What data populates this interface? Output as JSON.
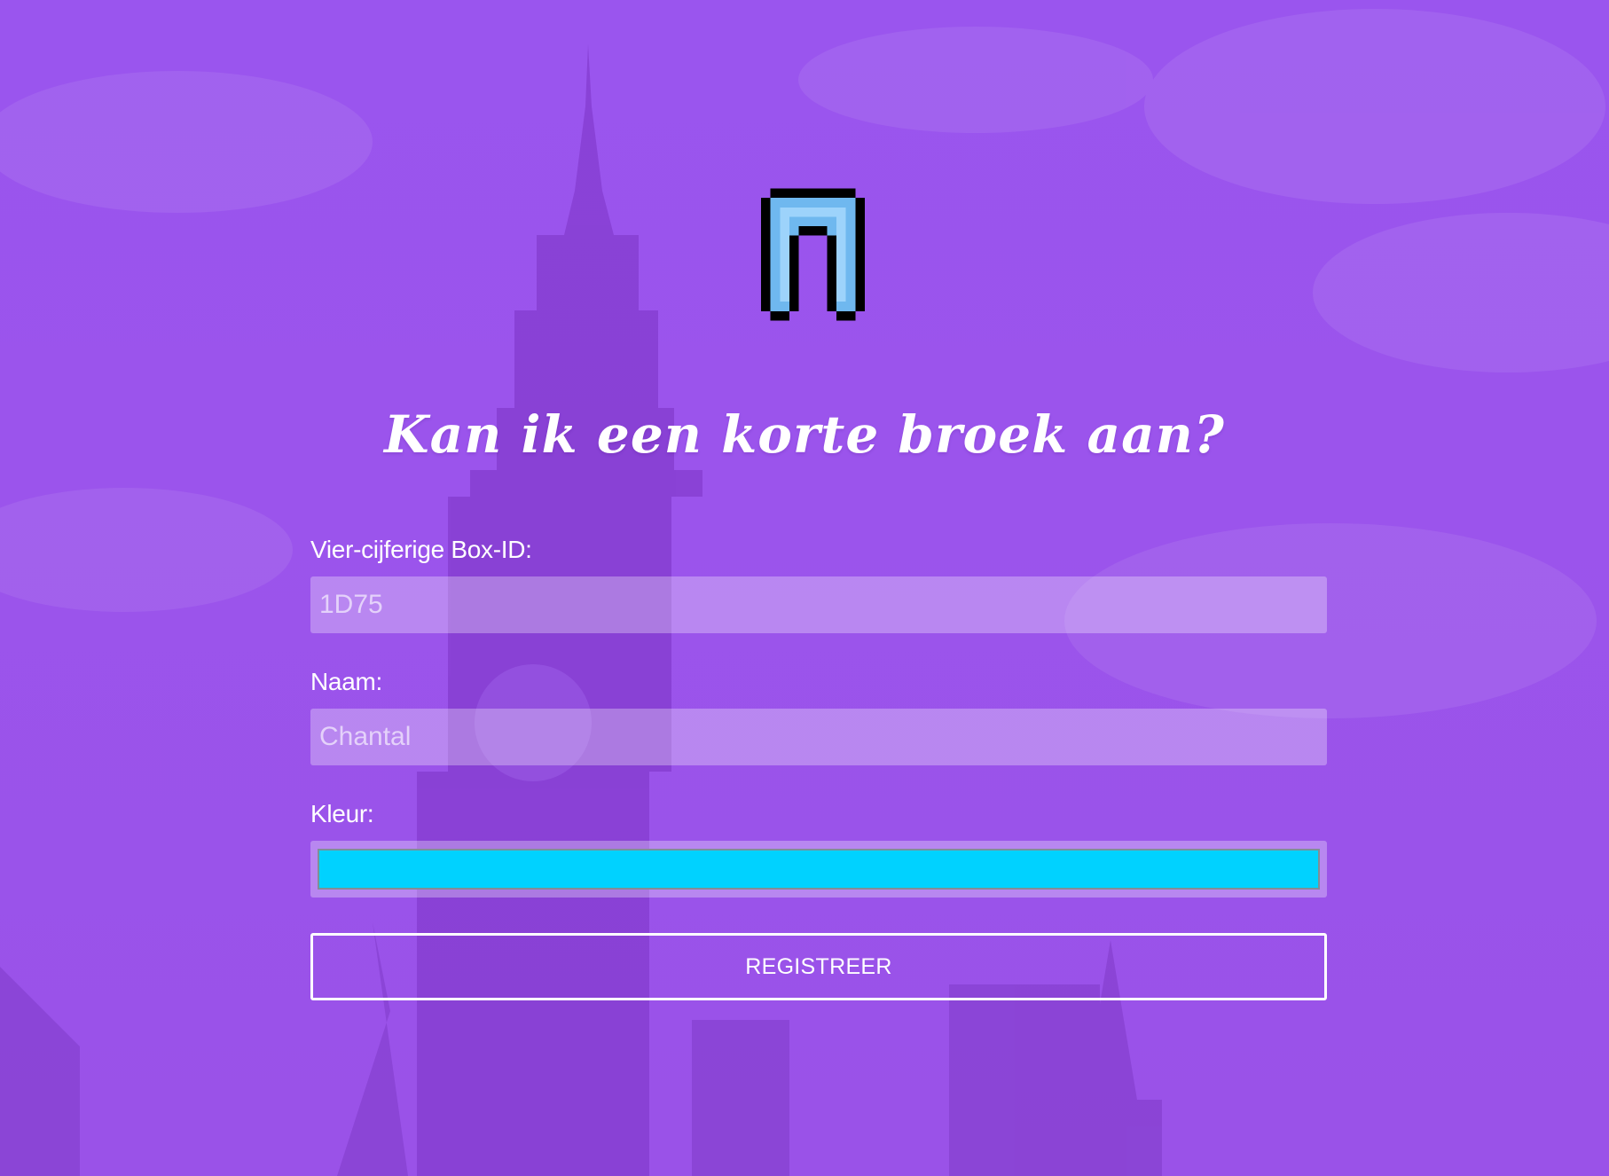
{
  "page": {
    "title": "Kan ik een korte broek aan?",
    "logo_icon": "shorts-icon",
    "accent_color": "#9b55ee"
  },
  "form": {
    "box_id": {
      "label": "Vier-cijferige Box-ID:",
      "placeholder": "1D75",
      "value": ""
    },
    "name": {
      "label": "Naam:",
      "placeholder": "Chantal",
      "value": ""
    },
    "color": {
      "label": "Kleur:",
      "value": "#00d2ff"
    },
    "submit_label": "REGISTREER"
  }
}
